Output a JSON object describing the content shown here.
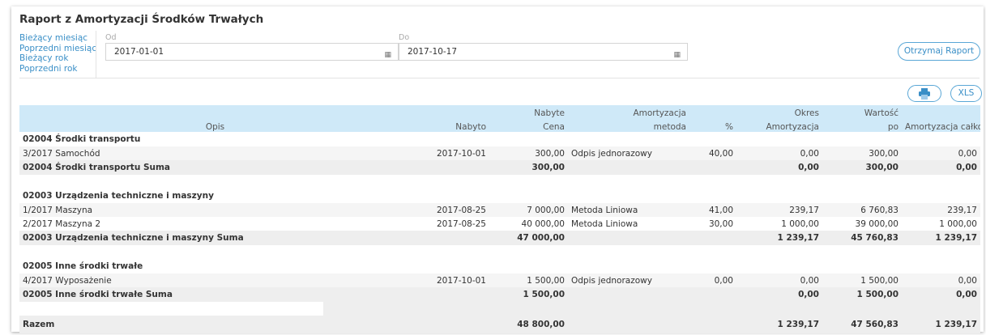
{
  "title": "Raport z Amortyzacji Środków Trwałych",
  "quick_links": [
    "Bieżący miesiąc",
    "Poprzedni miesiąc",
    "Bieżący rok",
    "Poprzedni rok"
  ],
  "from": {
    "label": "Od",
    "value": "2017-01-01"
  },
  "to": {
    "label": "Do",
    "value": "2017-10-17"
  },
  "get_report_label": "Otrzymaj Raport",
  "print_icon": "print-icon",
  "xls_label": "XLS",
  "headers": {
    "top": [
      "",
      "",
      "Nabyte",
      "Amortyzacja",
      "",
      "Okres",
      "Wartość",
      ""
    ],
    "bottom": [
      "Opis",
      "Nabyto",
      "Cena",
      "metoda",
      "%",
      "Amortyzacja",
      "po",
      "Amortyzacja całkowita"
    ]
  },
  "groups": [
    {
      "name": "02004 Środki transportu",
      "items": [
        {
          "opis": "3/2017 Samochód",
          "nabyto": "2017-10-01",
          "cena": "300,00",
          "metoda": "Odpis jednorazowy",
          "procent": "40,00",
          "okres": "0,00",
          "wartosc": "300,00",
          "calkowita": "0,00"
        }
      ],
      "sum": {
        "label": "02004 Środki transportu Suma",
        "cena": "300,00",
        "okres": "0,00",
        "wartosc": "300,00",
        "calkowita": "0,00"
      }
    },
    {
      "name": "02003 Urządzenia techniczne i maszyny",
      "items": [
        {
          "opis": "1/2017 Maszyna",
          "nabyto": "2017-08-25",
          "cena": "7 000,00",
          "metoda": "Metoda Liniowa",
          "procent": "41,00",
          "okres": "239,17",
          "wartosc": "6 760,83",
          "calkowita": "239,17"
        },
        {
          "opis": "2/2017 Maszyna 2",
          "nabyto": "2017-08-25",
          "cena": "40 000,00",
          "metoda": "Metoda Liniowa",
          "procent": "30,00",
          "okres": "1 000,00",
          "wartosc": "39 000,00",
          "calkowita": "1 000,00"
        }
      ],
      "sum": {
        "label": "02003 Urządzenia techniczne i maszyny Suma",
        "cena": "47 000,00",
        "okres": "1 239,17",
        "wartosc": "45 760,83",
        "calkowita": "1 239,17"
      }
    },
    {
      "name": "02005 Inne środki trwałe",
      "items": [
        {
          "opis": "4/2017 Wyposażenie",
          "nabyto": "2017-10-01",
          "cena": "1 500,00",
          "metoda": "Odpis jednorazowy",
          "procent": "0,00",
          "okres": "0,00",
          "wartosc": "1 500,00",
          "calkowita": "0,00"
        }
      ],
      "sum": {
        "label": "02005 Inne środki trwałe Suma",
        "cena": "1 500,00",
        "okres": "0,00",
        "wartosc": "1 500,00",
        "calkowita": "0,00"
      }
    }
  ],
  "total": {
    "label": "Razem",
    "cena": "48 800,00",
    "okres": "1 239,17",
    "wartosc": "47 560,83",
    "calkowita": "1 239,17"
  }
}
